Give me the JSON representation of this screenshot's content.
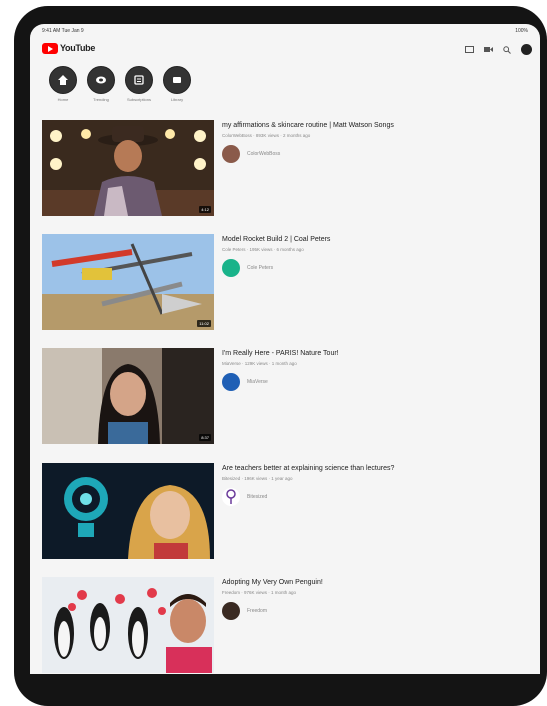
{
  "status": {
    "time": "9:41 AM  Tue Jan 9",
    "battery": "100%"
  },
  "app": {
    "name": "YouTube"
  },
  "topbar_icons": [
    "cast-icon",
    "camera-icon",
    "search-icon"
  ],
  "shortcuts": [
    {
      "label": "Home",
      "icon": "home-icon"
    },
    {
      "label": "Trending",
      "icon": "trending-icon"
    },
    {
      "label": "Subscriptions",
      "icon": "subscriptions-icon"
    },
    {
      "label": "Library",
      "icon": "library-icon"
    }
  ],
  "videos": [
    {
      "title": "my affirmations & skincare routine | Matt Watson Songs",
      "meta": "ColorWebBoss · 893K views · 2 months ago",
      "channel": "ColorWebBoss",
      "duration": "4:12",
      "avatar_color": "#8a5a4a"
    },
    {
      "title": "Model Rocket Build 2 | Coal Peters",
      "meta": "Cole Peters · 195K views · 6 months ago",
      "channel": "Cole Peters",
      "duration": "11:02",
      "avatar_color": "#19b38a"
    },
    {
      "title": "I'm Really Here - PARIS! Nature Tour!",
      "meta": "MiaVerse · 129K views · 1 month ago",
      "channel": "MiaVerse",
      "duration": "8:37",
      "avatar_color": "#1f5fb5"
    },
    {
      "title": "Are teachers better at explaining science than lectures?",
      "meta": "Bitesized · 196K views · 1 year ago",
      "channel": "Bitesized",
      "duration": "",
      "avatar_color": "#ffffff"
    },
    {
      "title": "Adopting My Very Own Penguin!",
      "meta": "Freedom · 976K views · 1 month ago",
      "channel": "Freedom",
      "duration": "",
      "avatar_color": "#3a2a22"
    }
  ]
}
